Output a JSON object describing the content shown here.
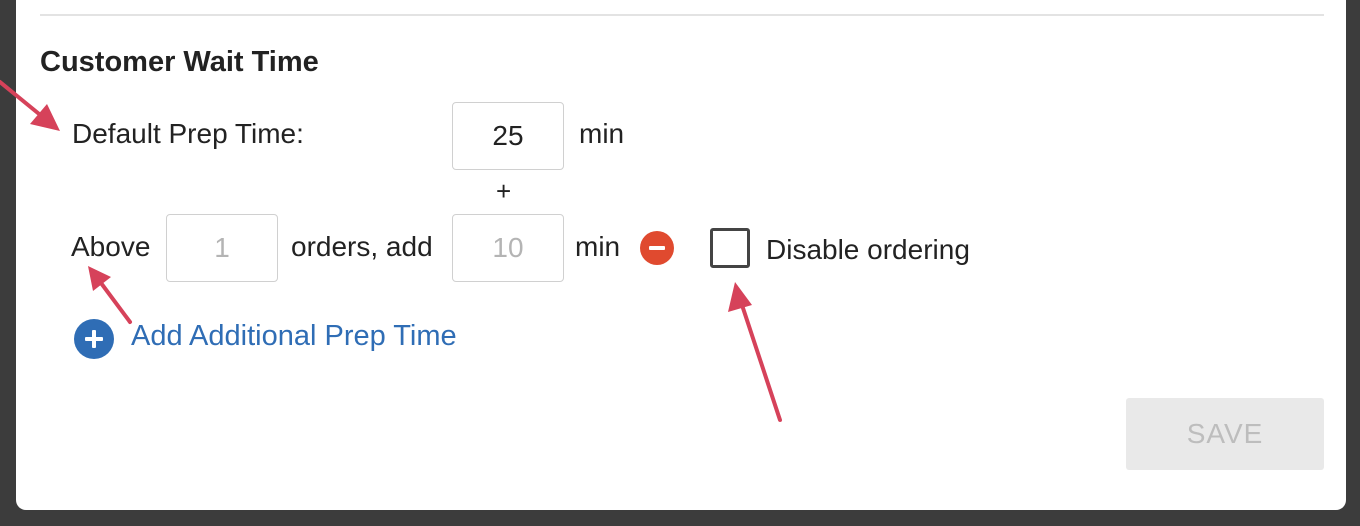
{
  "section": {
    "title": "Customer Wait Time"
  },
  "default_prep": {
    "label": "Default Prep Time:",
    "value": "25",
    "unit": "min"
  },
  "plus_sign": "+",
  "additional_rule": {
    "prefix": "Above",
    "orders_value": "1",
    "middle": "orders, add",
    "minutes_value": "10",
    "unit": "min"
  },
  "disable_ordering": {
    "label": "Disable ordering",
    "checked": false
  },
  "add_additional_label": "Add Additional Prep Time",
  "save_label": "SAVE",
  "colors": {
    "accent_blue": "#2f6db5",
    "remove_red": "#e04a2f",
    "annotation_arrow": "#d6425a"
  },
  "icons": {
    "remove": "minus-circle-icon",
    "add": "plus-circle-icon"
  }
}
